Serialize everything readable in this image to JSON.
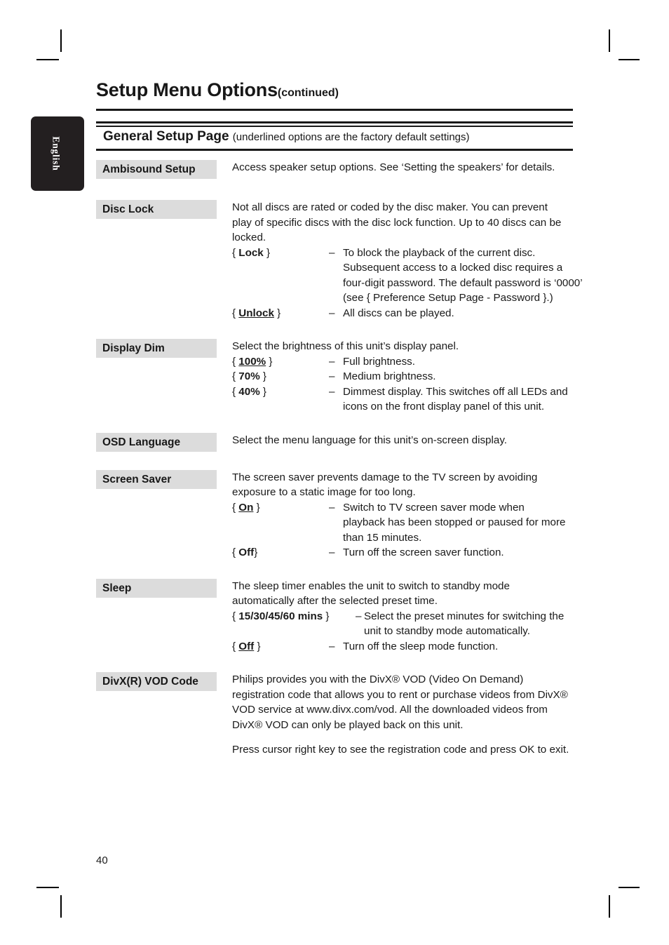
{
  "page": {
    "title": "Setup Menu Options",
    "title_suffix": "(continued)",
    "number": "40",
    "side_tab": "English"
  },
  "section": {
    "heading": "General Setup Page",
    "heading_note": "(underlined options are the factory default settings)"
  },
  "entries": [
    {
      "label": "Ambisound Setup",
      "paragraphs": [
        "Access speaker setup options.  See ‘Setting the speakers’ for details."
      ],
      "options": []
    },
    {
      "label": "Disc Lock",
      "paragraphs": [
        "Not all discs are rated or coded by the disc maker.  You can prevent play of specific discs with the disc lock function. Up to 40 discs can be locked."
      ],
      "options": [
        {
          "open": "{",
          "value": "Lock",
          "close": "}",
          "underlined": false,
          "dash": "–",
          "desc": "To block the playback of the current disc. Subsequent access to a locked disc requires a four-digit password.  The default password is ‘0000’ (see { Preference Setup Page - Password }.)"
        },
        {
          "open": "{",
          "value": "Unlock",
          "close": "}",
          "underlined": true,
          "dash": "–",
          "desc": "All discs can be played."
        }
      ]
    },
    {
      "label": "Display Dim",
      "paragraphs": [
        "Select the brightness of this unit’s display panel."
      ],
      "options": [
        {
          "open": "{",
          "value": "100%",
          "close": "}",
          "underlined": true,
          "dash": "–",
          "desc": "Full brightness."
        },
        {
          "open": "{",
          "value": "70%",
          "close": "}",
          "underlined": false,
          "dash": "–",
          "desc": "Medium brightness."
        },
        {
          "open": "{",
          "value": "40%",
          "close": "}",
          "underlined": false,
          "dash": "–",
          "desc": "Dimmest display.  This switches off all LEDs and icons on the front display panel of this unit."
        }
      ]
    },
    {
      "label": "OSD Language",
      "paragraphs": [
        "Select the menu language for this unit’s on-screen display."
      ],
      "options": []
    },
    {
      "label": "Screen Saver",
      "paragraphs": [
        "The screen saver prevents damage to the TV screen by avoiding exposure to a static image for too long."
      ],
      "options": [
        {
          "open": "{",
          "value": "On",
          "close": "}",
          "underlined": true,
          "dash": "–",
          "desc": "Switch to TV screen saver mode when playback has been stopped or paused for more than 15 minutes."
        },
        {
          "open": "{",
          "value": "Off",
          "close": "}",
          "underlined": false,
          "dash": "–",
          "desc": "Turn off the screen saver function."
        }
      ]
    },
    {
      "label": "Sleep",
      "paragraphs": [
        "The sleep timer enables the unit to switch to standby mode automatically after the selected preset time."
      ],
      "options": [
        {
          "open": "{",
          "value": "15/30/45/60 mins",
          "close": "}",
          "underlined": false,
          "dash": "–",
          "desc": "Select the preset minutes for switching the unit to standby mode automatically."
        },
        {
          "open": "{",
          "value": "Off",
          "close": "}",
          "underlined": true,
          "dash": "–",
          "desc": "Turn off the sleep mode function."
        }
      ]
    },
    {
      "label": "DivX(R) VOD Code",
      "paragraphs": [
        "Philips provides you with the DivX® VOD (Video On Demand) registration code that allows you to rent or purchase videos from DivX® VOD service at www.divx.com/vod.  All the downloaded videos from DivX® VOD can only be played back on this unit.",
        "Press cursor right key to see the registration code and press OK to exit."
      ],
      "options": []
    }
  ],
  "colors": {
    "label_background": "#dcdcdc",
    "tab_background": "#231f20",
    "text": "#1a1a1a",
    "rule": "#181818"
  }
}
